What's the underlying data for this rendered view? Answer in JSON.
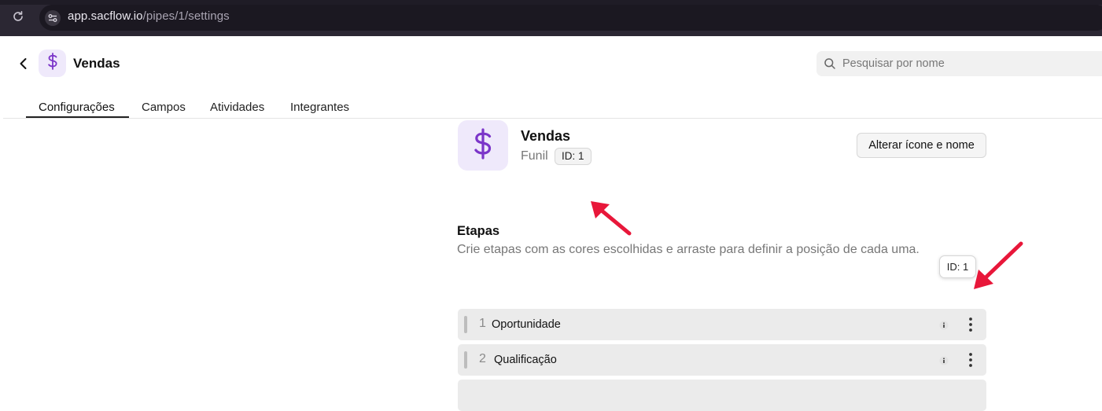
{
  "browser": {
    "url_host": "app.sacflow.io",
    "url_path": "/pipes/1/settings"
  },
  "header": {
    "title": "Vendas",
    "search_placeholder": "Pesquisar por nome"
  },
  "tabs": [
    {
      "label": "Configurações",
      "active": true
    },
    {
      "label": "Campos",
      "active": false
    },
    {
      "label": "Atividades",
      "active": false
    },
    {
      "label": "Integrantes",
      "active": false
    }
  ],
  "pipe": {
    "name": "Vendas",
    "type": "Funil",
    "id_badge": "ID: 1",
    "icon": "dollar-icon",
    "accent_color": "#7b35c9",
    "avatar_bg": "#efe9fb",
    "edit_button": "Alterar ícone e nome"
  },
  "stages_section": {
    "title": "Etapas",
    "description": "Crie etapas com as cores escolhidas e arraste para definir a posição de cada uma.",
    "tooltip": "ID: 1",
    "items": [
      {
        "number": "1",
        "name": "Oportunidade"
      },
      {
        "number": "2",
        "name": "Qualificação"
      }
    ]
  },
  "annotations": {
    "arrow_color": "#e8173a"
  }
}
